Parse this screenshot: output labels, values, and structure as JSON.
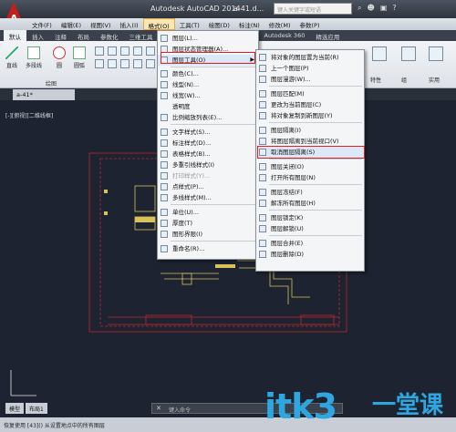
{
  "titlebar": {
    "app_title": "Autodesk AutoCAD 2014",
    "file_name": "a-41.d...",
    "search_placeholder": "键入关键字或短语",
    "icons": [
      "search-icon",
      "user-icon",
      "cart-icon",
      "help-icon"
    ]
  },
  "menubar": {
    "items": [
      "文件(F)",
      "编辑(E)",
      "视图(V)",
      "插入(I)",
      "格式(O)",
      "工具(T)",
      "绘图(D)",
      "标注(N)",
      "修改(M)",
      "参数(P)"
    ]
  },
  "ribbon_tabs": [
    "默认",
    "插入",
    "注释",
    "布局",
    "参数化",
    "三维工具",
    "Autodesk 360",
    "精选应用"
  ],
  "ribbon": {
    "tools": [
      "直线",
      "多段线",
      "圆",
      "圆弧"
    ],
    "panel_draw": "绘图",
    "right_labels": [
      "特性",
      "组",
      "实用"
    ]
  },
  "doc_tab": "a-41*",
  "viewport_label": "[-][俯视][二维线框]",
  "format_menu": {
    "items": [
      {
        "label": "图层(L)...",
        "icon": "layer-icon",
        "enabled": true
      },
      {
        "label": "图层状态管理器(A)...",
        "icon": "layer-state-icon",
        "enabled": true
      },
      {
        "label": "图层工具(O)",
        "icon": "layer-tools-icon",
        "enabled": true,
        "submenu": true
      },
      {
        "label": "颜色(C)...",
        "icon": "color-icon",
        "enabled": true
      },
      {
        "label": "线型(N)...",
        "icon": "linetype-icon",
        "enabled": true
      },
      {
        "label": "线宽(W)...",
        "icon": "lineweight-icon",
        "enabled": true
      },
      {
        "label": "透明度",
        "icon": "transparency-icon",
        "enabled": true
      },
      {
        "label": "比例缩放列表(E)...",
        "icon": "scale-list-icon",
        "enabled": true
      },
      {
        "label": "文字样式(S)...",
        "icon": "text-style-icon",
        "enabled": true
      },
      {
        "label": "标注样式(D)...",
        "icon": "dim-style-icon",
        "enabled": true
      },
      {
        "label": "表格样式(B)...",
        "icon": "table-style-icon",
        "enabled": true
      },
      {
        "label": "多重引线样式(I)",
        "icon": "mleader-style-icon",
        "enabled": true
      },
      {
        "label": "打印样式(Y)...",
        "icon": "plot-style-icon",
        "enabled": false
      },
      {
        "label": "点样式(P)...",
        "icon": "point-style-icon",
        "enabled": true
      },
      {
        "label": "多线样式(M)...",
        "icon": "mline-style-icon",
        "enabled": true
      },
      {
        "label": "单位(U)...",
        "icon": "units-icon",
        "enabled": true
      },
      {
        "label": "厚度(T)",
        "icon": "thickness-icon",
        "enabled": true
      },
      {
        "label": "图形界限(I)",
        "icon": "limits-icon",
        "enabled": true
      },
      {
        "label": "重命名(R)...",
        "icon": "rename-icon",
        "enabled": true
      }
    ]
  },
  "layer_tools_menu": {
    "items": [
      {
        "label": "将对象的图层置为当前(R)"
      },
      {
        "label": "上一个图层(P)"
      },
      {
        "label": "图层漫游(W)..."
      },
      {
        "label": "图层匹配(M)"
      },
      {
        "label": "更改为当前图层(C)"
      },
      {
        "label": "将对象复制到新图层(Y)"
      },
      {
        "label": "图层隔离(I)"
      },
      {
        "label": "将图层隔离到当前视口(V)"
      },
      {
        "label": "取消图层隔离(S)"
      },
      {
        "label": "图层关闭(O)"
      },
      {
        "label": "打开所有图层(N)"
      },
      {
        "label": "图层冻结(F)"
      },
      {
        "label": "解冻所有图层(H)"
      },
      {
        "label": "图层锁定(K)"
      },
      {
        "label": "图层解锁(U)"
      },
      {
        "label": "图层合并(E)"
      },
      {
        "label": "图层删除(D)"
      }
    ]
  },
  "layout_tabs": [
    "模型",
    "布局1"
  ],
  "command_placeholder": "键入命令",
  "statusbar_text": "恢复使用  [43]()  从设置地点中的所有图层",
  "watermark": {
    "latin": "itk3",
    "cn": "一堂课"
  }
}
